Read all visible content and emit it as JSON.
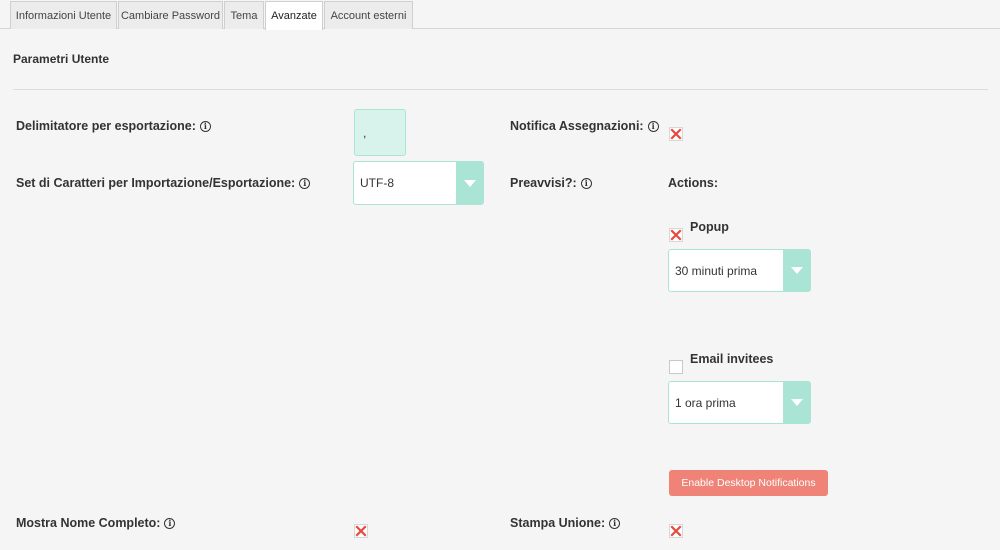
{
  "tabs": [
    {
      "label": "Informazioni Utente"
    },
    {
      "label": "Cambiare Password"
    },
    {
      "label": "Tema"
    },
    {
      "label": "Avanzate"
    },
    {
      "label": "Account esterni"
    }
  ],
  "section": {
    "title": "Parametri Utente"
  },
  "fields": {
    "export_delimiter": {
      "label": "Delimitatore per esportazione:",
      "value": ","
    },
    "charset": {
      "label": "Set di Caratteri per Importazione/Esportazione:",
      "value": "UTF-8"
    },
    "notify_assignments": {
      "label": "Notifica Assegnazioni:",
      "checked": false
    },
    "reminders": {
      "label": "Preavvisi?:",
      "actions_label": "Actions:"
    },
    "popup": {
      "label": "Popup",
      "select_value": "30 minuti prima"
    },
    "email_invitees": {
      "label": "Email invitees",
      "select_value": "1 ora prima"
    },
    "desktop_notifications_button": "Enable Desktop Notifications",
    "show_full_name": {
      "label": "Mostra Nome Completo:"
    },
    "mail_merge": {
      "label": "Stampa Unione:"
    }
  },
  "icons": {
    "info": "info-icon",
    "unchecked": "x-mark-icon",
    "dropdown": "chevron-down-icon"
  },
  "colors": {
    "accent": "#a9e4d4",
    "input_bg": "#d8f3ec",
    "button": "#f08377",
    "x_mark": "#e8493e"
  }
}
